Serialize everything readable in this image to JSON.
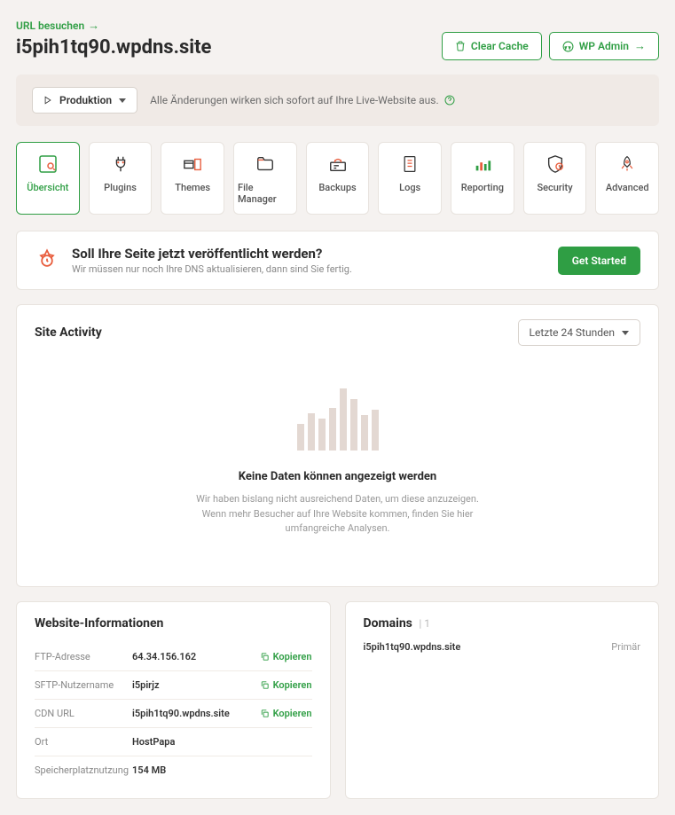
{
  "header": {
    "visit_url": "URL besuchen",
    "site_title": "i5pih1tq90.wpdns.site",
    "clear_cache": "Clear Cache",
    "wp_admin": "WP Admin"
  },
  "notice": {
    "env_label": "Produktion",
    "text": "Alle Änderungen wirken sich sofort auf Ihre Live-Website aus."
  },
  "tabs": [
    {
      "label": "Übersicht",
      "icon": "overview"
    },
    {
      "label": "Plugins",
      "icon": "plugins"
    },
    {
      "label": "Themes",
      "icon": "themes"
    },
    {
      "label": "File Manager",
      "icon": "files"
    },
    {
      "label": "Backups",
      "icon": "backups"
    },
    {
      "label": "Logs",
      "icon": "logs"
    },
    {
      "label": "Reporting",
      "icon": "reporting"
    },
    {
      "label": "Security",
      "icon": "security"
    },
    {
      "label": "Advanced",
      "icon": "advanced"
    }
  ],
  "publish": {
    "title": "Soll Ihre Seite jetzt veröffentlicht werden?",
    "subtitle": "Wir müssen nur noch Ihre DNS aktualisieren, dann sind Sie fertig.",
    "button": "Get Started"
  },
  "activity": {
    "title": "Site Activity",
    "range": "Letzte 24 Stunden",
    "empty_title": "Keine Daten können angezeigt werden",
    "empty_text": "Wir haben bislang nicht ausreichend Daten, um diese anzuzeigen. Wenn mehr Besucher auf Ihre Website kommen, finden Sie hier umfangreiche Analysen."
  },
  "chart_data": {
    "type": "bar",
    "categories": [],
    "values": [],
    "title": "Site Activity",
    "xlabel": "",
    "ylabel": "",
    "ylim": [
      0,
      0
    ]
  },
  "info": {
    "title": "Website-Informationen",
    "copy_label": "Kopieren",
    "rows": [
      {
        "label": "FTP-Adresse",
        "value": "64.34.156.162",
        "copy": true
      },
      {
        "label": "SFTP-Nutzername",
        "value": "i5pirjz",
        "copy": true
      },
      {
        "label": "CDN URL",
        "value": "i5pih1tq90.wpdns.site",
        "copy": true
      },
      {
        "label": "Ort",
        "value": "HostPapa",
        "copy": false
      },
      {
        "label": "Speicherplatznutzung",
        "value": "154 MB",
        "copy": false
      }
    ]
  },
  "domains": {
    "title": "Domains",
    "count": "| 1",
    "items": [
      {
        "name": "i5pih1tq90.wpdns.site",
        "tag": "Primär"
      }
    ]
  }
}
